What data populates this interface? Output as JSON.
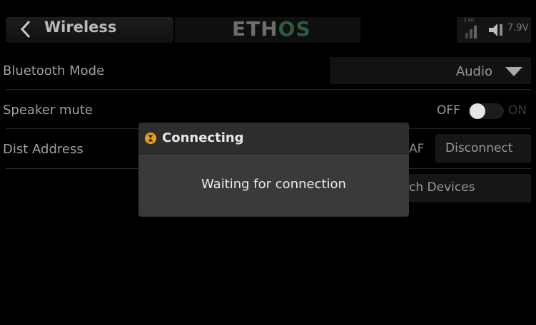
{
  "header": {
    "title": "Wireless",
    "logo_main": "ETH",
    "logo_accent": "OS",
    "band": "2.4G",
    "voltage": "7.9V"
  },
  "rows": [
    {
      "label": "Bluetooth Mode",
      "value": "Audio"
    },
    {
      "label": "Speaker mute",
      "toggle_off": "OFF",
      "toggle_on": "ON",
      "state": "OFF"
    },
    {
      "label": "Dist Address",
      "value_partial": "AF",
      "button": "Disconnect"
    },
    {
      "button_partial": "ch Devices"
    }
  ],
  "dialog": {
    "title": "Connecting",
    "message": "Waiting for connection"
  },
  "colors": {
    "background": "#000000",
    "dialog": "#3a3a3a",
    "hourglass": "#e2a21d",
    "logo_accent": "#2e5b3e"
  },
  "icons": [
    "back-arrow-icon",
    "signal-bars-icon",
    "speaker-icon",
    "hourglass-icon",
    "dropdown-arrow-icon"
  ]
}
